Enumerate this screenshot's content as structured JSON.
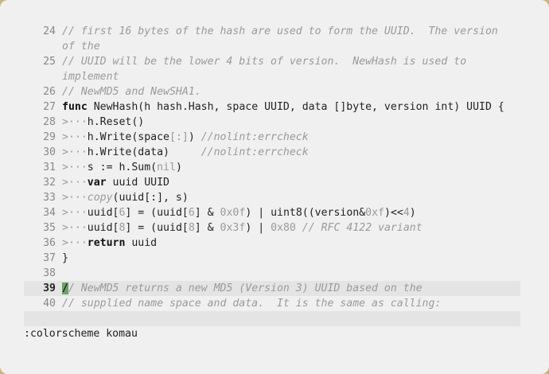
{
  "editor": {
    "lines": [
      {
        "num": "24",
        "parts": [
          {
            "t": "// first 16 bytes of the hash are used to form the UUID.  The version",
            "c": "c"
          }
        ]
      },
      {
        "num": "",
        "parts": [
          {
            "t": "of the",
            "c": "c"
          }
        ]
      },
      {
        "num": "25",
        "parts": [
          {
            "t": "// UUID will be the lower 4 bits of version.  NewHash is used to",
            "c": "c"
          }
        ]
      },
      {
        "num": "",
        "parts": [
          {
            "t": "implement",
            "c": "c"
          }
        ]
      },
      {
        "num": "26",
        "parts": [
          {
            "t": "// NewMD5 and NewSHA1.",
            "c": "c"
          }
        ]
      },
      {
        "num": "27",
        "parts": [
          {
            "t": "func",
            "c": "k"
          },
          {
            "t": " NewHash(h hash.Hash, space UUID, data []byte, version int) UUID {",
            "c": ""
          }
        ]
      },
      {
        "num": "28",
        "parts": [
          {
            "t": ">···",
            "c": "ws"
          },
          {
            "t": "h.Reset()",
            "c": ""
          }
        ]
      },
      {
        "num": "29",
        "parts": [
          {
            "t": ">···",
            "c": "ws"
          },
          {
            "t": "h.Write(space",
            "c": ""
          },
          {
            "t": "[:]",
            "c": "b"
          },
          {
            "t": ") ",
            "c": ""
          },
          {
            "t": "//nolint:errcheck",
            "c": "c"
          }
        ]
      },
      {
        "num": "30",
        "parts": [
          {
            "t": ">···",
            "c": "ws"
          },
          {
            "t": "h.Write(data)     ",
            "c": ""
          },
          {
            "t": "//nolint:errcheck",
            "c": "c"
          }
        ]
      },
      {
        "num": "31",
        "parts": [
          {
            "t": ">···",
            "c": "ws"
          },
          {
            "t": "s := h.Sum(",
            "c": ""
          },
          {
            "t": "nil",
            "c": "n"
          },
          {
            "t": ")",
            "c": ""
          }
        ]
      },
      {
        "num": "32",
        "parts": [
          {
            "t": ">···",
            "c": "ws"
          },
          {
            "t": "var",
            "c": "k"
          },
          {
            "t": " uuid UUID",
            "c": ""
          }
        ]
      },
      {
        "num": "33",
        "parts": [
          {
            "t": ">···",
            "c": "ws"
          },
          {
            "t": "copy",
            "c": "c"
          },
          {
            "t": "(uuid[:], s)",
            "c": ""
          }
        ]
      },
      {
        "num": "34",
        "parts": [
          {
            "t": ">···",
            "c": "ws"
          },
          {
            "t": "uuid[",
            "c": ""
          },
          {
            "t": "6",
            "c": "n"
          },
          {
            "t": "] = (uuid[",
            "c": ""
          },
          {
            "t": "6",
            "c": "n"
          },
          {
            "t": "] & ",
            "c": ""
          },
          {
            "t": "0x0f",
            "c": "n"
          },
          {
            "t": ") | uint8((version&",
            "c": ""
          },
          {
            "t": "0xf",
            "c": "n"
          },
          {
            "t": ")<<",
            "c": ""
          },
          {
            "t": "4",
            "c": "n"
          },
          {
            "t": ")",
            "c": ""
          }
        ]
      },
      {
        "num": "35",
        "parts": [
          {
            "t": ">···",
            "c": "ws"
          },
          {
            "t": "uuid[",
            "c": ""
          },
          {
            "t": "8",
            "c": "n"
          },
          {
            "t": "] = (uuid[",
            "c": ""
          },
          {
            "t": "8",
            "c": "n"
          },
          {
            "t": "] & ",
            "c": ""
          },
          {
            "t": "0x3f",
            "c": "n"
          },
          {
            "t": ") | ",
            "c": ""
          },
          {
            "t": "0x80",
            "c": "n"
          },
          {
            "t": " ",
            "c": ""
          },
          {
            "t": "// RFC 4122 variant",
            "c": "c"
          }
        ]
      },
      {
        "num": "36",
        "parts": [
          {
            "t": ">···",
            "c": "ws"
          },
          {
            "t": "return",
            "c": "k"
          },
          {
            "t": " uuid",
            "c": ""
          }
        ]
      },
      {
        "num": "37",
        "parts": [
          {
            "t": "}",
            "c": ""
          }
        ]
      },
      {
        "num": "38",
        "parts": []
      },
      {
        "num": "39",
        "current": true,
        "parts": [
          {
            "t": "/",
            "c": "cursor"
          },
          {
            "t": "/ NewMD5 returns a new MD5 (Version 3) UUID based on the",
            "c": "c"
          }
        ]
      },
      {
        "num": "40",
        "parts": [
          {
            "t": "// supplied name space and data.  It is the same as calling:",
            "c": "c"
          }
        ]
      }
    ]
  },
  "command_line": ":colorscheme komau",
  "colors": {
    "background": "#f0f0f0",
    "cursor": "#6aa36a",
    "cursorline": "#e4e4e4",
    "comment": "#9a9a9a",
    "keyword": "#111111"
  }
}
